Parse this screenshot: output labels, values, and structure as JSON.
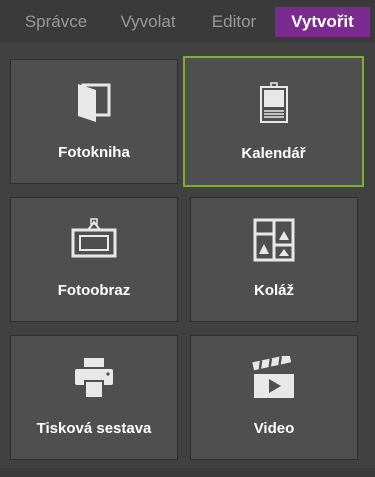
{
  "tabs": [
    {
      "label": "Správce",
      "active": false
    },
    {
      "label": "Vyvolat",
      "active": false
    },
    {
      "label": "Editor",
      "active": false
    },
    {
      "label": "Vytvořit",
      "active": true
    }
  ],
  "tiles": [
    {
      "label": "Fotokniha",
      "icon": "photobook-icon",
      "selected": false
    },
    {
      "label": "Kalendář",
      "icon": "calendar-icon",
      "selected": true
    },
    {
      "label": "Fotoobraz",
      "icon": "framed-picture-icon",
      "selected": false
    },
    {
      "label": "Koláž",
      "icon": "collage-icon",
      "selected": false
    },
    {
      "label": "Tisková sestava",
      "icon": "printer-icon",
      "selected": false
    },
    {
      "label": "Video",
      "icon": "video-clapper-icon",
      "selected": false
    }
  ],
  "colors": {
    "background": "#414141",
    "tile": "#4f4f4f",
    "active_tab": "#7b2a8f",
    "selected_border": "#7ab02e",
    "inactive_tab_text": "#9a9a9a"
  }
}
